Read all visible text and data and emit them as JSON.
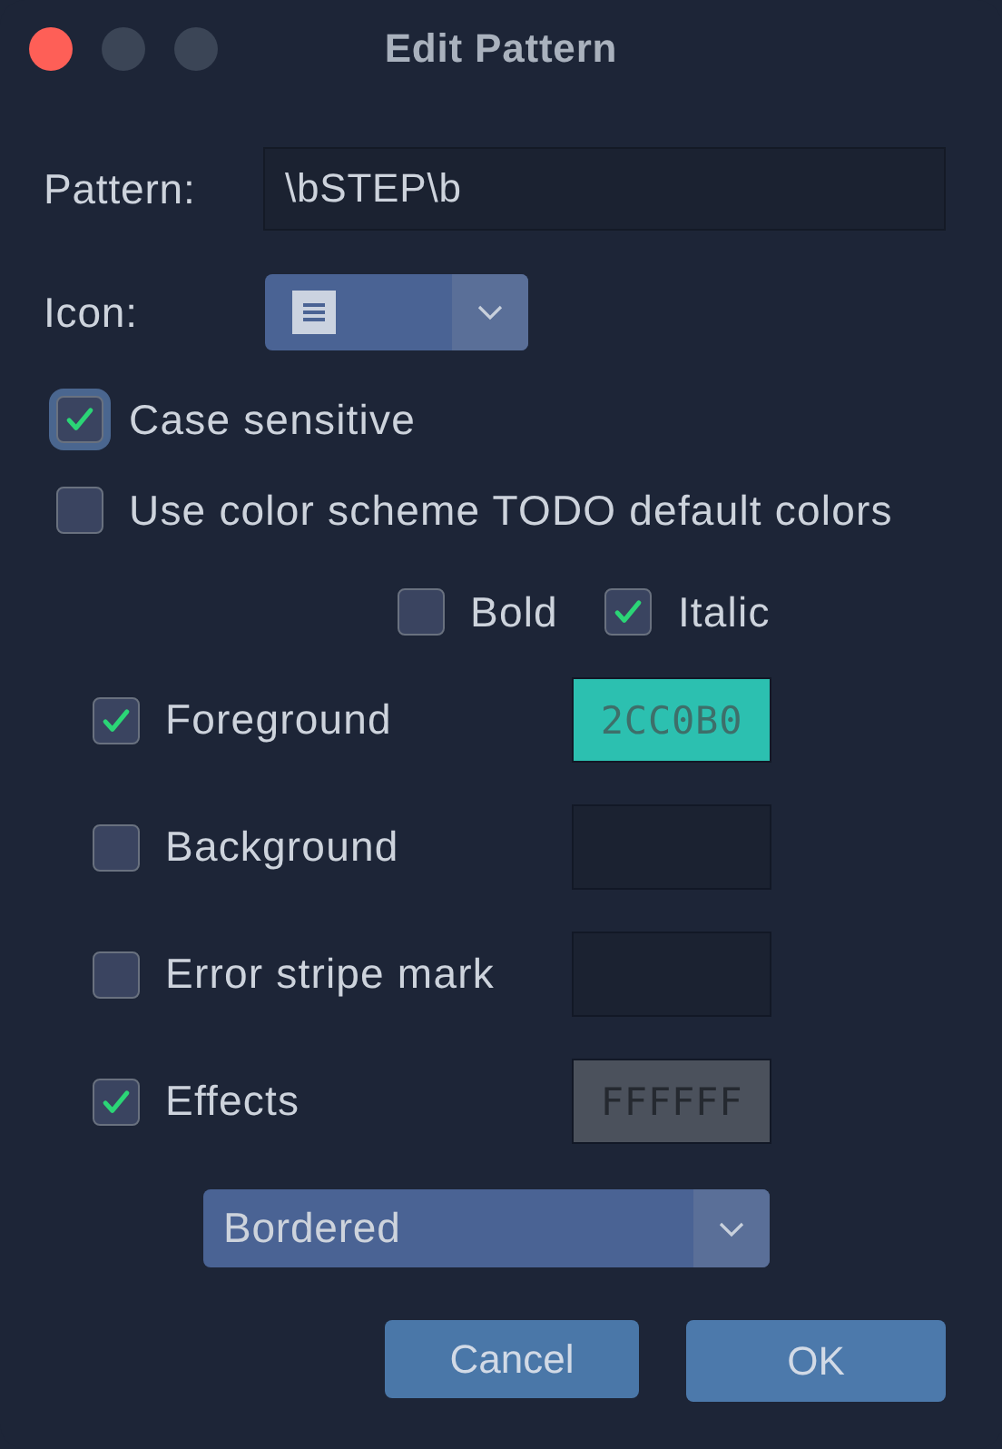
{
  "window": {
    "title": "Edit Pattern"
  },
  "pattern": {
    "label": "Pattern:",
    "value": "\\bSTEP\\b"
  },
  "icon": {
    "label": "Icon:"
  },
  "options": [
    {
      "label": "Case sensitive",
      "checked": true,
      "focused": true
    },
    {
      "label": "Use color scheme TODO default colors",
      "checked": false,
      "focused": false
    }
  ],
  "font_styles": [
    {
      "label": "Bold",
      "checked": false
    },
    {
      "label": "Italic",
      "checked": true
    }
  ],
  "attributes": [
    {
      "label": "Foreground",
      "checked": true,
      "swatch": {
        "value": "2CC0B0",
        "color": "#2cc0b0",
        "disabled": false
      }
    },
    {
      "label": "Background",
      "checked": false,
      "swatch": {
        "disabled": false
      }
    },
    {
      "label": "Error stripe mark",
      "checked": false,
      "swatch": {
        "disabled": false
      }
    },
    {
      "label": "Effects",
      "checked": true,
      "swatch": {
        "value": "FFFFFF",
        "disabled": true
      }
    }
  ],
  "effect_type": {
    "value": "Bordered"
  },
  "buttons": [
    {
      "label": "Cancel",
      "default": false
    },
    {
      "label": "OK",
      "default": true
    }
  ]
}
